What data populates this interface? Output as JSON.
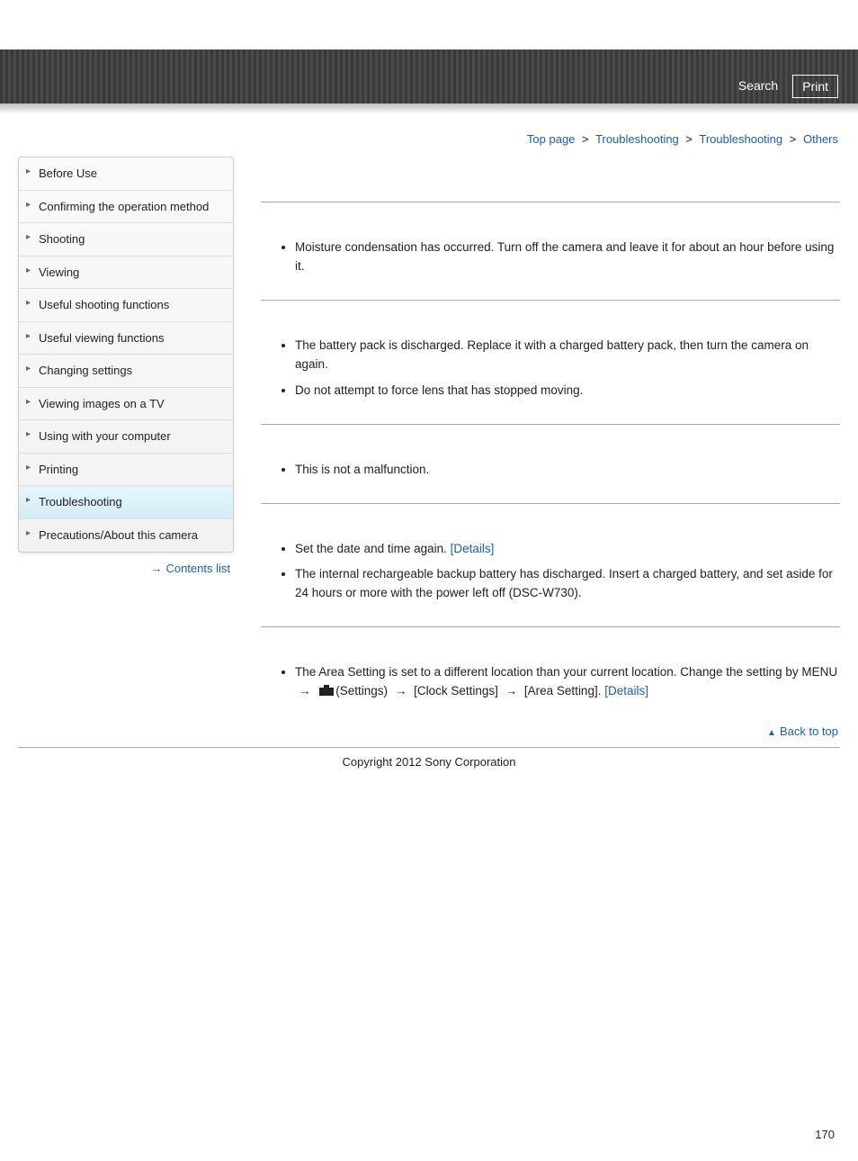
{
  "header": {
    "search_label": "Search",
    "print_label": "Print"
  },
  "breadcrumb": {
    "top": "Top page",
    "trouble1": "Troubleshooting",
    "trouble2": "Troubleshooting",
    "others": "Others",
    "sep": ">"
  },
  "sidebar": {
    "items": [
      {
        "label": "Before Use"
      },
      {
        "label": "Confirming the operation method"
      },
      {
        "label": "Shooting"
      },
      {
        "label": "Viewing"
      },
      {
        "label": "Useful shooting functions"
      },
      {
        "label": "Useful viewing functions"
      },
      {
        "label": "Changing settings"
      },
      {
        "label": "Viewing images on a TV"
      },
      {
        "label": "Using with your computer"
      },
      {
        "label": "Printing"
      },
      {
        "label": "Troubleshooting"
      },
      {
        "label": "Precautions/About this camera"
      }
    ],
    "active_index": 10,
    "contents_list_label": "Contents list"
  },
  "content": {
    "sections": [
      {
        "items": [
          {
            "text": "Moisture condensation has occurred. Turn off the camera and leave it for about an hour before using it."
          }
        ]
      },
      {
        "items": [
          {
            "text": "The battery pack is discharged. Replace it with a charged battery pack, then turn the camera on again."
          },
          {
            "text": "Do not attempt to force lens that has stopped moving."
          }
        ]
      },
      {
        "items": [
          {
            "text": "This is not a malfunction."
          }
        ]
      },
      {
        "items": [
          {
            "text": "Set the date and time again. ",
            "details": "[Details]"
          },
          {
            "text": "The internal rechargeable backup battery has discharged. Insert a charged battery, and set aside for 24 hours or more with the power left off (DSC-W730)."
          }
        ]
      },
      {
        "items": [
          {
            "prefix": "The Area Setting is set to a different location than your current location. Change the setting by MENU",
            "settings_label": "(Settings)",
            "clock_label": "[Clock Settings]",
            "area_label": "[Area Setting].",
            "details": "[Details]",
            "arrow": "→",
            "is_menu_path": true
          }
        ]
      }
    ],
    "back_to_top": "Back to top"
  },
  "footer": {
    "copyright": "Copyright 2012 Sony Corporation",
    "page_number": "170"
  }
}
